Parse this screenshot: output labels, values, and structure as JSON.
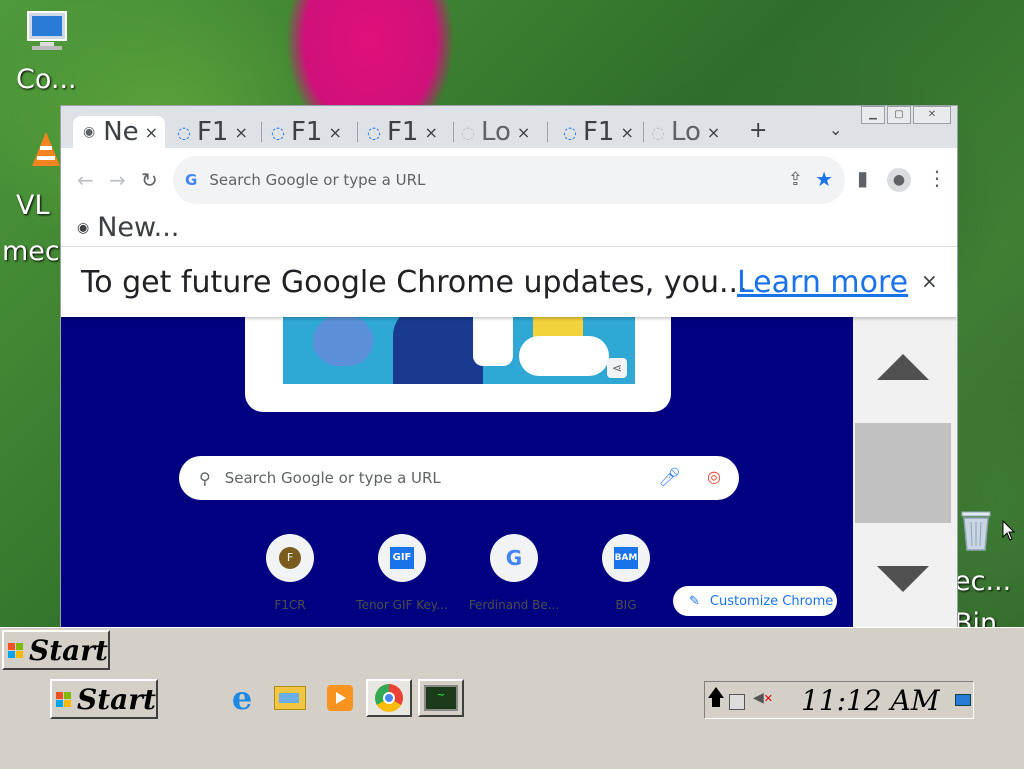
{
  "desktop": {
    "icons": [
      {
        "label": "Co...",
        "icon": "computer-icon"
      },
      {
        "label": "VL",
        "label2": "mec",
        "icon": "vlc-icon"
      },
      {
        "label": "ec...",
        "label2": "Bin",
        "icon": "recycle-bin-icon"
      }
    ]
  },
  "browser": {
    "tabs": [
      {
        "title": "Ne",
        "icon": "chrome-icon",
        "active": true
      },
      {
        "title": "F1",
        "icon": "loading-icon"
      },
      {
        "title": "F1",
        "icon": "loading-icon"
      },
      {
        "title": "F1",
        "icon": "loading-icon"
      },
      {
        "title": "Lo",
        "icon": "loading-icon"
      },
      {
        "title": "F1",
        "icon": "loading-icon"
      },
      {
        "title": "Lo",
        "icon": "loading-icon"
      }
    ],
    "tab_close": "×",
    "new_tab": "+",
    "tab_list": "⌄",
    "omnibox_placeholder": "Search Google or type a URL",
    "bookmark": {
      "label": "New...",
      "icon": "globe-icon"
    },
    "infobar": {
      "message": "To get future Google Chrome updates, you...",
      "link": "Learn more",
      "close": "×"
    },
    "ntp": {
      "search_placeholder": "Search Google or type a URL",
      "shortcuts": [
        {
          "label": "F1CR",
          "glyph": "F",
          "color": "#7a5c1e"
        },
        {
          "label": "Tenor GIF Key...",
          "glyph": "GIF",
          "color": "#1a73e8"
        },
        {
          "label": "Ferdinand Be...",
          "glyph": "G",
          "color": "#4285f4"
        },
        {
          "label": "BIG",
          "glyph": "BAM",
          "color": "#1a73e8"
        }
      ],
      "customize_label": "Customize Chrome"
    }
  },
  "taskbar": {
    "start_label": "Start",
    "start_label_2": "Start",
    "clock": "11:12 AM"
  }
}
